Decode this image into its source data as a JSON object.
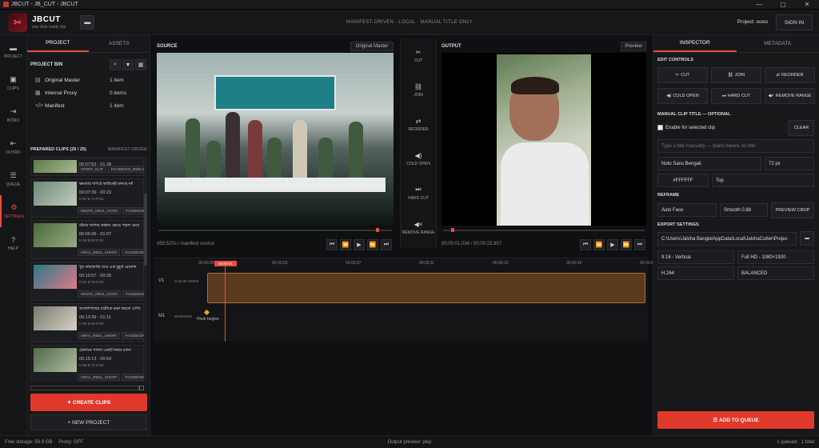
{
  "window": {
    "title": "JBCUT - JB_CUT - JBCUT",
    "controls": [
      "—",
      "▢",
      "✕"
    ]
  },
  "app": {
    "brand": "JBCUT",
    "tagline": "one click ready clip",
    "center_tag": "MANIFEST-DRIVEN · LOCAL · MANUAL TITLE ONLY",
    "project_label": "Project: oooo",
    "signin": "SIGN IN",
    "accent": "#e0392b"
  },
  "nav": [
    {
      "label": "PROJECT",
      "icon": "folder-icon",
      "glyph": "▬"
    },
    {
      "label": "CLIPS",
      "icon": "film-icon",
      "glyph": "▣"
    },
    {
      "label": "INTRO",
      "icon": "enter-icon",
      "glyph": "⇥"
    },
    {
      "label": "OUTRO",
      "icon": "exit-icon",
      "glyph": "⇤"
    },
    {
      "label": "QUEUE",
      "icon": "list-icon",
      "glyph": "☰"
    },
    {
      "label": "SETTINGS",
      "icon": "gear-icon",
      "glyph": "⚙"
    },
    {
      "label": "HELP",
      "icon": "help-icon",
      "glyph": "?"
    }
  ],
  "left": {
    "tabs": [
      "PROJECT",
      "ASSETS"
    ],
    "bin_title": "PROJECT BIN",
    "bin": [
      {
        "icon": "▤",
        "name": "Original Master",
        "count": "1 item"
      },
      {
        "icon": "▦",
        "name": "Internal Proxy",
        "count": "0 items"
      },
      {
        "icon": "</>",
        "name": "Manifest",
        "count": "1 item"
      }
    ],
    "clips_title": "PREPARED CLIPS (25 / 25)",
    "clips_sort": "MANIFEST ORDER",
    "clips": [
      {
        "title": "",
        "time": "00:07:52  ·  01:28",
        "sub": "H:63  E:68  R:81",
        "tags": [
          "STORY_CLIP",
          "FACEBOOK_REELS",
          "YO"
        ]
      },
      {
        "title": "ক্ষমতার দাপটে কাউকেই মানছে না!",
        "time": "00:07:39  ·  00:23",
        "sub": "H:92  E:74  R:81",
        "tags": [
          "MICRO_VIRAL_HOOK",
          "FACEBOOK_REELS"
        ]
      },
      {
        "title": "বাঁচার আশায় কান্নায় ভেঙে পড়ল মেয়ে",
        "time": "00:06:36  ·  01:07",
        "sub": "H:66  E:80  R:81",
        "tags": [
          "VIRAL_REEL_SHORT",
          "FACEBOOK_REELS"
        ]
      },
      {
        "title": "খুব কাছাকাছি আর এক মুহূর্ত রোমান্স",
        "time": "00:10:57  ·  00:39",
        "sub": "H:61  E:76  R:82",
        "tags": [
          "MICRO_VIRAL_HOOK",
          "FACEBOOK_REELS"
        ]
      },
      {
        "title": "আকাশপথের যাত্রীকে রক্ষা করতে এগিয়ে এল",
        "time": "00:13:39  ·  01:11",
        "sub": "H:86  E:86  R:80",
        "tags": [
          "VIRAL_REEL_SHORT",
          "FACEBOOK_REELS"
        ]
      },
      {
        "title": "টেনশনে পাগল একটি নির্মম ঘটনা",
        "time": "00:15:13  ·  00:54",
        "sub": "H:90  E:72  R:84",
        "tags": [
          "VIRAL_REEL_SHORT",
          "FACEBOOK_REELS"
        ]
      }
    ],
    "create": "CREATE CLIPS",
    "new_project": "NEW PROJECT"
  },
  "source": {
    "label": "SOURCE",
    "mode": "Original Master",
    "timecode": "459.520s / manifest source"
  },
  "edit_col": [
    {
      "label": "CUT",
      "icon": "scissors-icon",
      "glyph": "✂"
    },
    {
      "label": "JOIN",
      "icon": "link-icon",
      "glyph": "⛓"
    },
    {
      "label": "REORDER",
      "icon": "swap-icon",
      "glyph": "⇄"
    },
    {
      "label": "COLD OPEN",
      "icon": "cold-open-icon",
      "glyph": "◀)"
    },
    {
      "label": "HARD CUT",
      "icon": "hard-cut-icon",
      "glyph": "⏭"
    },
    {
      "label": "REMOVE RANGE",
      "icon": "remove-range-icon",
      "glyph": "◀×"
    }
  ],
  "output": {
    "label": "OUTPUT",
    "mode": "Preview",
    "timecode": "00:00:01.034 / 00:00:23.857"
  },
  "timeline": {
    "ruler": [
      "00:00:00",
      "00:00:03",
      "00:00:07",
      "00:00:11",
      "00:00:15",
      "00:00:19",
      "00:00:2"
    ],
    "playhead": "00:00:01",
    "tracks": [
      {
        "id": "V1",
        "name": "CLEAN VIDEO"
      },
      {
        "id": "M1",
        "name": "MARKERS"
      }
    ],
    "marker": "Hook begins",
    "transport": [
      "⏮",
      "⏪",
      "▶",
      "⏩",
      "⏭"
    ]
  },
  "inspector": {
    "tabs": [
      "INSPECTOR",
      "METADATA"
    ],
    "edit_title": "EDIT CONTROLS",
    "edit_buttons": [
      "CUT",
      "JOIN",
      "REORDER",
      "COLD OPEN",
      "HARD CUT",
      "REMOVE RANGE"
    ],
    "edit_glyphs": [
      "✂",
      "⛓",
      "⇄",
      "◀)",
      "⏭",
      "◀×"
    ],
    "manual_title": "MANUAL CLIP TITLE — OPTIONAL",
    "enable": "Enable for selected clip",
    "clear": "CLEAR",
    "title_placeholder": "Type a title manually — blank means no title",
    "font": "Noto Sans Bengali",
    "size": "72 px",
    "color": "#FFFFFF",
    "position": "Top",
    "reframe_title": "REFRAME",
    "reframe": "Auto Face",
    "smooth": "Smooth 0.88",
    "preview_crop": "PREVIEW CROP",
    "export_title": "EXPORT SETTINGS",
    "path": "C:\\Users\\Jalsha Bangla\\AppData\\Local\\JalshaCutter\\Projec",
    "aspect": "9:16 - Vertical",
    "res": "Full HD - 1080×1920",
    "codec": "H.264",
    "preset": "BALANCED",
    "queue": "ADD TO QUEUE"
  },
  "status": {
    "storage": "Free storage: 59.9 GB",
    "proxy": "Proxy: OFF",
    "preview": "Output preview: play",
    "queue": "1 queued · 1 total"
  }
}
